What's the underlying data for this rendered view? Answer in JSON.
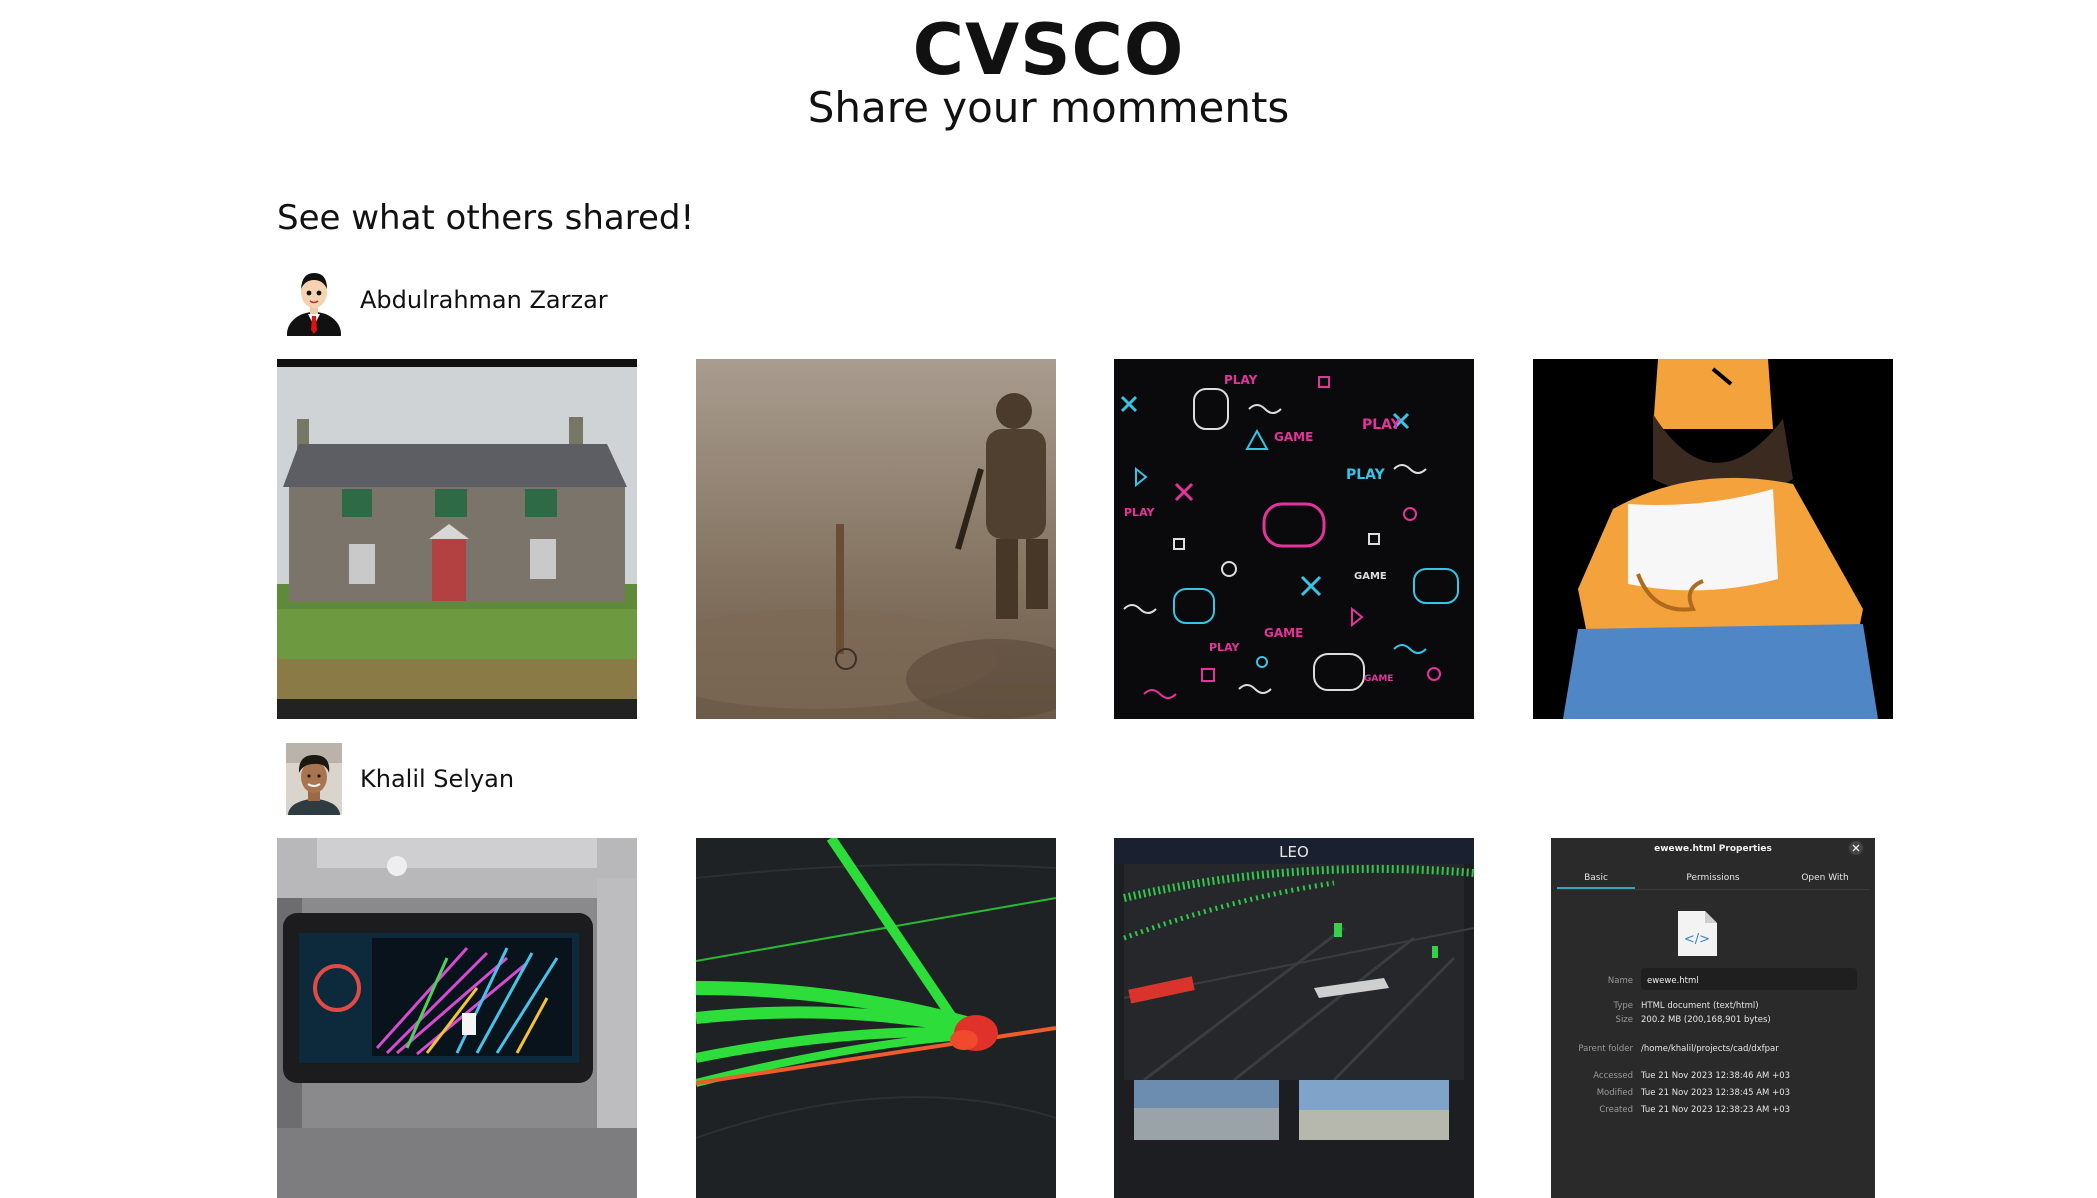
{
  "header": {
    "title": "CVSCO",
    "subtitle": "Share your momments"
  },
  "feed": {
    "heading": "See what others shared!",
    "users": [
      {
        "name": "Abdulrahman Zarzar",
        "avatar_icon": "cartoon-businessman-avatar",
        "photos": [
          {
            "name": "stone-cottage-photo"
          },
          {
            "name": "toy-soldier-photo"
          },
          {
            "name": "game-pattern-photo",
            "labels": [
              "PLAY",
              "GAME"
            ]
          },
          {
            "name": "cartoon-character-photo"
          }
        ]
      },
      {
        "name": "Khalil Selyan",
        "avatar_icon": "profile-photo-avatar",
        "photos": [
          {
            "name": "bus-screen-photo"
          },
          {
            "name": "lidar-trajectory-photo"
          },
          {
            "name": "point-cloud-photo",
            "brand": "LEO"
          },
          {
            "name": "file-properties-photo",
            "dialog": {
              "title": "ewewe.html Properties",
              "tabs": [
                "Basic",
                "Permissions",
                "Open With"
              ],
              "rows": [
                {
                  "label": "Name",
                  "value": "ewewe.html"
                },
                {
                  "label": "Type",
                  "value": "HTML document (text/html)"
                },
                {
                  "label": "Size",
                  "value": "200.2 MB (200,168,901 bytes)"
                },
                {
                  "label": "Parent folder",
                  "value": "/home/khalil/projects/cad/dxfpar"
                },
                {
                  "label": "Accessed",
                  "value": "Tue 21 Nov 2023 12:38:46 AM +03"
                },
                {
                  "label": "Modified",
                  "value": "Tue 21 Nov 2023 12:38:45 AM +03"
                },
                {
                  "label": "Created",
                  "value": "Tue 21 Nov 2023 12:38:23 AM +03"
                }
              ]
            }
          }
        ]
      }
    ]
  }
}
